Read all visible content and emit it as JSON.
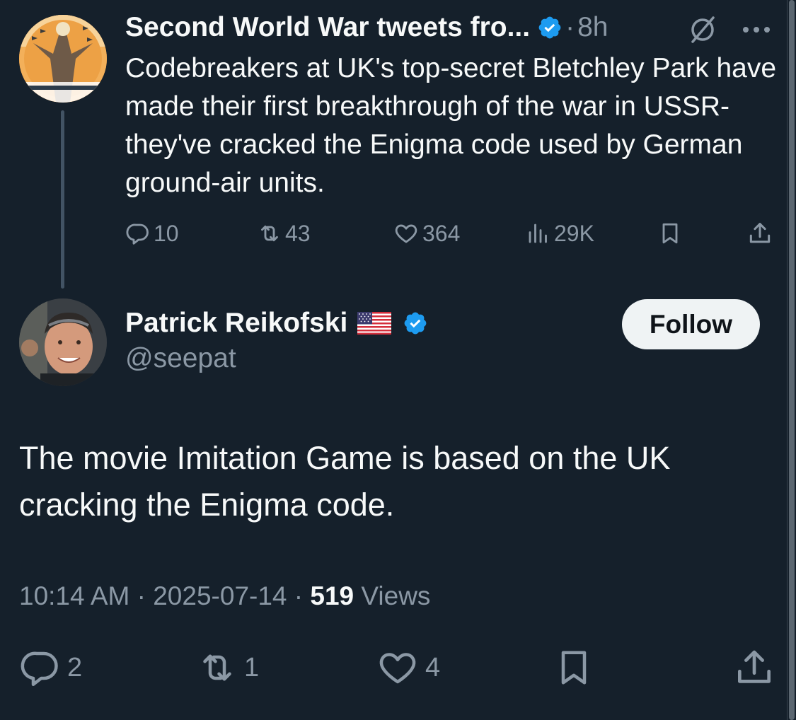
{
  "parent_tweet": {
    "author_name": "Second World War tweets fro...",
    "separator": "·",
    "time": "8h",
    "text": "Codebreakers at UK's top-secret Bletchley Park have made their first breakthrough of the war in USSR- they've cracked the Enigma code used by German ground-air units.",
    "stats": {
      "replies": "10",
      "reposts": "43",
      "likes": "364",
      "views": "29K"
    }
  },
  "reply_tweet": {
    "author_name": "Patrick Reikofski",
    "handle": "@seepat",
    "follow_label": "Follow",
    "text": "The movie Imitation Game is based on the UK cracking the Enigma code.",
    "time": "10:14 AM",
    "separator": "·",
    "date": "2025-07-14",
    "views_count": "519",
    "views_label": "Views",
    "stats": {
      "replies": "2",
      "reposts": "1",
      "likes": "4"
    }
  },
  "colors": {
    "background": "#15202b",
    "text_primary": "#f7f9f9",
    "text_secondary": "#8b98a5",
    "verified_blue": "#1d9bf0",
    "thread_line": "#425364",
    "follow_button_bg": "#eff3f4"
  }
}
